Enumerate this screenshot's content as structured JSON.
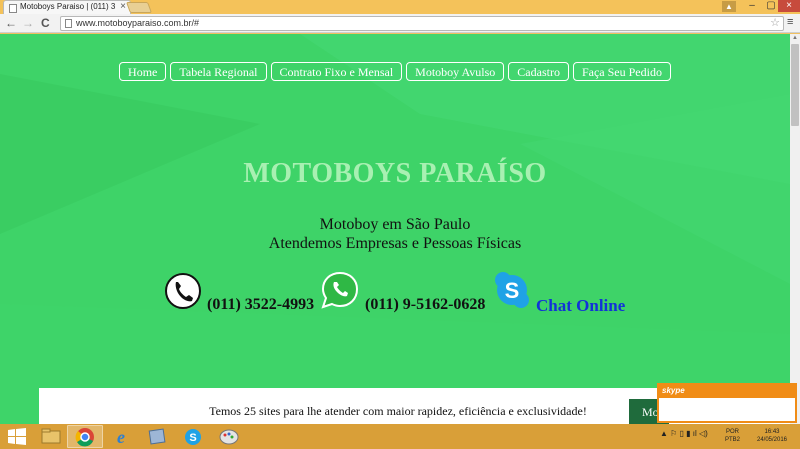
{
  "browser": {
    "tab_title": "Motoboys Paraiso | (011) 3",
    "tab_close": "×",
    "url": "www.motoboyparaiso.com.br/#",
    "back": "←",
    "forward": "→",
    "reload": "C",
    "star": "☆",
    "menu": "≡",
    "win_min": "–",
    "win_max": "▢",
    "win_close": "×",
    "scroll_up": "▲",
    "scroll_down": "▼"
  },
  "nav": {
    "items": [
      {
        "label": "Home"
      },
      {
        "label": "Tabela Regional"
      },
      {
        "label": "Contrato Fixo e Mensal"
      },
      {
        "label": "Motoboy Avulso"
      },
      {
        "label": "Cadastro"
      },
      {
        "label": "Faça Seu Pedido"
      }
    ]
  },
  "hero": {
    "title": "MOTOBOYS PARAÍSO",
    "subtitle1": "Motoboy em São Paulo",
    "subtitle2": "Atendemos Empresas e Pessoas Físicas"
  },
  "contacts": {
    "phone": "(011) 3522-4993",
    "whatsapp": "(011) 9-5162-0628",
    "chat": "Chat Online"
  },
  "banner": {
    "text": "Temos 25 sites para lhe atender com maior rapidez, eficiência e exclusividade!",
    "button": "Mo"
  },
  "skype_popup": {
    "logo": "skype"
  },
  "taskbar": {
    "lang_top": "POR",
    "lang_bottom": "PTB2",
    "time": "16:43",
    "date": "24/05/2016"
  },
  "colors": {
    "page_green": "#3ed368",
    "title_green": "#a8f0b2",
    "chat_blue": "#1232d8",
    "skype_orange": "#f08c16",
    "taskbar": "#d99f38"
  }
}
